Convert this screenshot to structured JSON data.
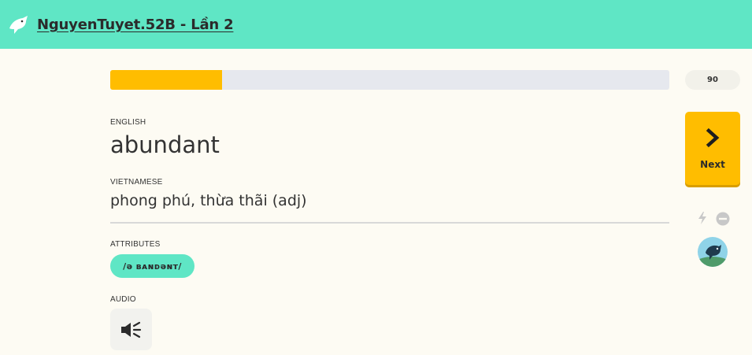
{
  "header": {
    "course_title": "NguyenTuyet.52B - Lần 2",
    "logo_icon": "fox-logo-icon"
  },
  "progress": {
    "fraction": 0.2,
    "score": "90"
  },
  "card": {
    "english_label": "ENGLISH",
    "english_word": "abundant",
    "vietnamese_label": "VIETNAMESE",
    "vietnamese_text": "phong phú, thừa thãi (adj)",
    "attributes_label": "ATTRIBUTES",
    "pronunciation": "/ə ʙᴀɴᴅəɴᴛ/",
    "audio_label": "AUDIO",
    "audio_icon": "speaker-icon"
  },
  "sidebar": {
    "next_label": "Next",
    "next_icon": "chevron-right-icon",
    "lightning_icon": "lightning-icon",
    "ignore_icon": "minus-circle-icon",
    "avatar_icon": "avatar"
  },
  "colors": {
    "header_bg": "#5fe6c5",
    "progress_fill": "#ffbd00",
    "progress_track": "#e6e8ee",
    "next_button": "#ffbd00",
    "page_bg": "#fdfbf3"
  }
}
